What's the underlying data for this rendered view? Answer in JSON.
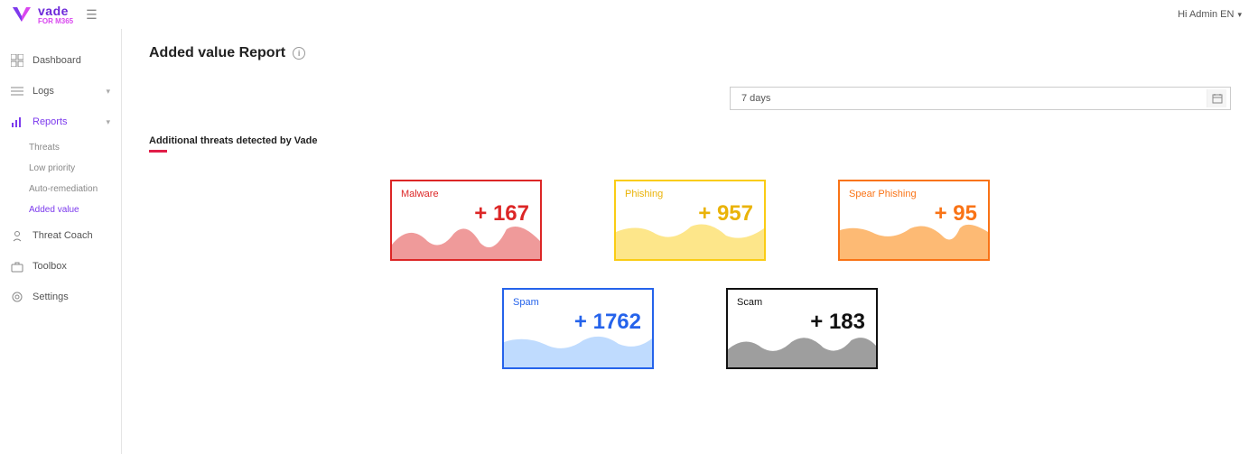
{
  "brand": {
    "name": "vade",
    "sub": "FOR M365"
  },
  "user_label": "Hi Admin EN",
  "sidebar": {
    "items": [
      {
        "label": "Dashboard"
      },
      {
        "label": "Logs"
      },
      {
        "label": "Reports"
      },
      {
        "label": "Threat Coach"
      },
      {
        "label": "Toolbox"
      },
      {
        "label": "Settings"
      }
    ],
    "reports_sub": [
      {
        "label": "Threats"
      },
      {
        "label": "Low priority"
      },
      {
        "label": "Auto-remediation"
      },
      {
        "label": "Added value"
      }
    ]
  },
  "page": {
    "title": "Added value Report",
    "date_range": "7 days",
    "section_label": "Additional threats detected by Vade"
  },
  "cards": {
    "malware": {
      "label": "Malware",
      "value": "+ 167",
      "fill": "#ef9a9a"
    },
    "phishing": {
      "label": "Phishing",
      "value": "+ 957",
      "fill": "#fde68a"
    },
    "spear": {
      "label": "Spear Phishing",
      "value": "+ 95",
      "fill": "#fdba74"
    },
    "spam": {
      "label": "Spam",
      "value": "+ 1762",
      "fill": "#bfdbfe"
    },
    "scam": {
      "label": "Scam",
      "value": "+ 183",
      "fill": "#9e9e9e"
    }
  }
}
